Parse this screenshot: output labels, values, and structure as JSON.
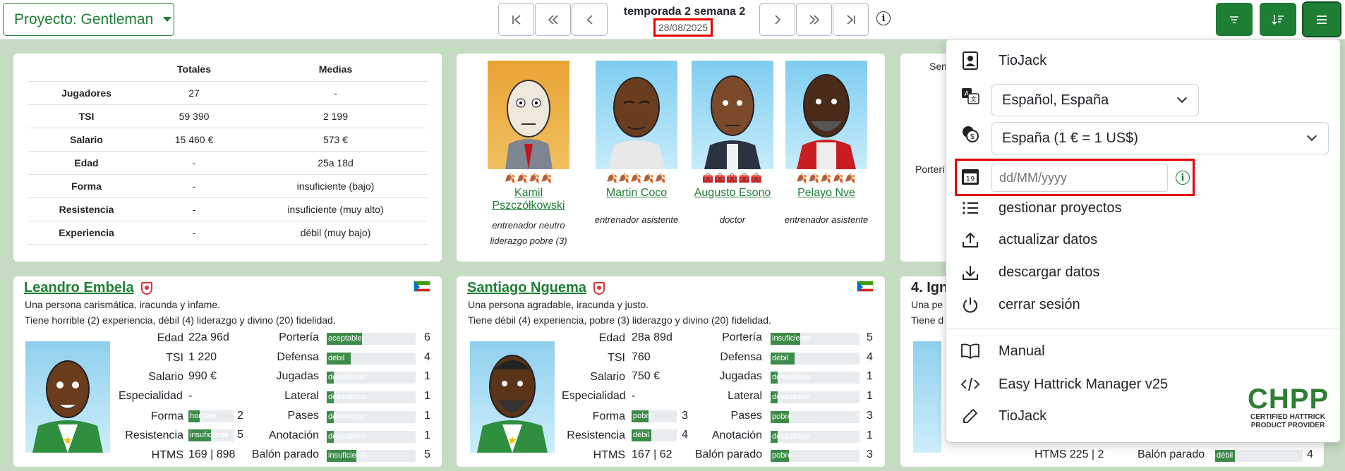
{
  "header": {
    "project_label": "Proyecto: Gentleman",
    "season": "temporada 2 semana 2",
    "date": "28/08/2025",
    "info_icon": "i"
  },
  "summary": {
    "headers": [
      "",
      "Totales",
      "Medias"
    ],
    "rows": [
      [
        "Jugadores",
        "27",
        "-"
      ],
      [
        "TSI",
        "59 390",
        "2 199"
      ],
      [
        "Salario",
        "15 460 €",
        "573 €"
      ],
      [
        "Edad",
        "-",
        "25a 18d"
      ],
      [
        "Forma",
        "-",
        "insuficiente (bajo)"
      ],
      [
        "Resistencia",
        "-",
        "insuficiente (muy alto)"
      ],
      [
        "Experiencia",
        "-",
        "débil (muy bajo)"
      ]
    ]
  },
  "staff": [
    {
      "name": "Kamil Pszczółkowski",
      "stars": "🍂🍂🍂🍂",
      "role1": "entrenador neutro",
      "role2": "liderazgo pobre (3)"
    },
    {
      "name": "Martin Coco",
      "stars": "🍂🍂🍂🍂🍂",
      "role1": "entrenador asistente",
      "role2": ""
    },
    {
      "name": "Augusto Esono",
      "stars": "🧰🧰🧰🧰🧰",
      "role1": "doctor",
      "role2": ""
    },
    {
      "name": "Pelayo Nve",
      "stars": "🍂🍂🍂🍂🍂",
      "role1": "entrenador asistente",
      "role2": ""
    }
  ],
  "partial_left": {
    "sem": "Sem",
    "porteri": "Porterí",
    "ign": "4. Ign",
    "una": "Una pe",
    "tiene": "Tiene d"
  },
  "players": [
    {
      "name": "Leandro Embela",
      "desc1": "Una persona carismática, iracunda y infame.",
      "desc2": "Tiene horrible (2) experiencia, débil (4) liderazgo y divino (20) fidelidad.",
      "edad": "22a 96d",
      "tsi": "1 220",
      "salario": "990 €",
      "especialidad": "-",
      "forma": "horrible",
      "forma_n": "2",
      "resistencia": "insuficiente",
      "resistencia_n": "5",
      "htms": "169 | 898",
      "skills": [
        [
          "Portería",
          "aceptable",
          "6"
        ],
        [
          "Defensa",
          "débil",
          "4"
        ],
        [
          "Jugadas",
          "desastroso",
          "1"
        ],
        [
          "Lateral",
          "desastroso",
          "1"
        ],
        [
          "Pases",
          "desastroso",
          "1"
        ],
        [
          "Anotación",
          "desastroso",
          "1"
        ],
        [
          "Balón parado",
          "insuficiente",
          "5"
        ]
      ]
    },
    {
      "name": "Santiago Nguema",
      "desc1": "Una persona agradable, iracunda y justo.",
      "desc2": "Tiene débil (4) experiencia, pobre (3) liderazgo y divino (20) fidelidad.",
      "edad": "28a 89d",
      "tsi": "760",
      "salario": "750 €",
      "especialidad": "-",
      "forma": "pobre",
      "forma_n": "3",
      "resistencia": "débil",
      "resistencia_n": "4",
      "htms": "167 | 62",
      "skills": [
        [
          "Portería",
          "insuficiente",
          "5"
        ],
        [
          "Defensa",
          "débil",
          "4"
        ],
        [
          "Jugadas",
          "desastroso",
          "1"
        ],
        [
          "Lateral",
          "desastroso",
          "1"
        ],
        [
          "Pases",
          "pobre",
          "3"
        ],
        [
          "Anotación",
          "desastroso",
          "1"
        ],
        [
          "Balón parado",
          "pobre",
          "3"
        ]
      ]
    }
  ],
  "third_player": {
    "htms": "HTMS 225 | 2",
    "balon": "Balón parado",
    "balon_val": "débil",
    "balon_n": "4"
  },
  "labels": {
    "edad": "Edad",
    "tsi": "TSI",
    "salario": "Salario",
    "especialidad": "Especialidad",
    "forma": "Forma",
    "resistencia": "Resistencia",
    "htms": "HTMS"
  },
  "menu": {
    "user": "TioJack",
    "language": "Español, España",
    "currency": "España (1 € = 1 US$)",
    "date_placeholder": "dd/MM/yyyy",
    "manage": "gestionar proyectos",
    "update": "actualizar datos",
    "download": "descargar datos",
    "logout": "cerrar sesión",
    "manual": "Manual",
    "app": "Easy Hattrick Manager v25",
    "author": "TioJack",
    "calendar_day": "19"
  },
  "chpp": {
    "logo": "CHPP",
    "line1": "CERTIFIED HATTRICK",
    "line2": "PRODUCT PROVIDER"
  },
  "colors": {
    "accent": "#1e7e34",
    "highlight": "#e60000",
    "bar_fill": "#3d8b4a"
  }
}
